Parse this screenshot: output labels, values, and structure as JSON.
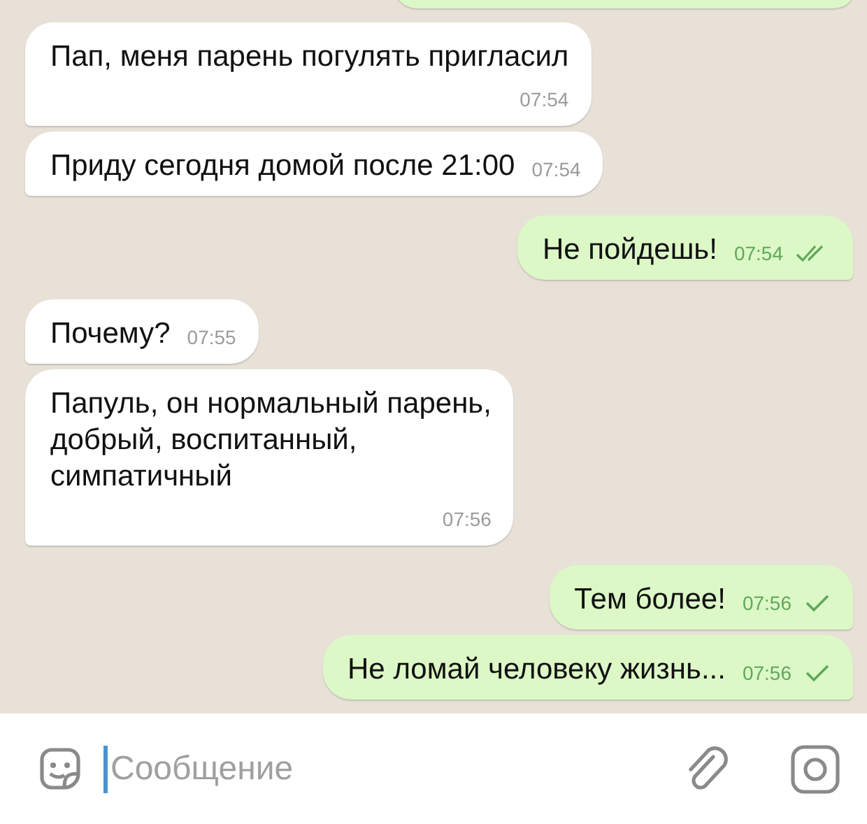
{
  "messages": [
    {
      "outgoing": false,
      "text": "Пап, меня парень погулять пригласил",
      "time": "07:54",
      "time_below": true
    },
    {
      "outgoing": false,
      "text": "Приду сегодня домой после 21:00",
      "time": "07:54",
      "time_below": false
    },
    {
      "outgoing": true,
      "text": "Не пойдешь!",
      "time": "07:54",
      "time_below": false,
      "read": true
    },
    {
      "outgoing": false,
      "text": "Почему?",
      "time": "07:55",
      "time_below": false
    },
    {
      "outgoing": false,
      "text": "Папуль, он нормальный парень,\nдобрый, воспитанный,\nсимпатичный",
      "time": "07:56",
      "time_below": true
    },
    {
      "outgoing": true,
      "text": "Тем более!",
      "time": "07:56",
      "time_below": false,
      "read": false
    },
    {
      "outgoing": true,
      "text": "Не ломай человеку жизнь...",
      "time": "07:56",
      "time_below": false,
      "read": false
    }
  ],
  "composer": {
    "placeholder": "Сообщение"
  }
}
